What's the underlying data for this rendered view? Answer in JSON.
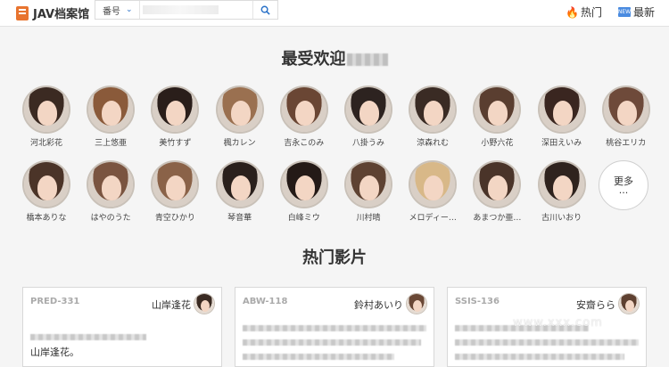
{
  "header": {
    "logo_text": "JAV档案馆",
    "search_select": "番号",
    "search_placeholder": "",
    "nav_hot": "热门",
    "nav_new": "最新",
    "new_badge": "NEW"
  },
  "sections": {
    "popular_title": "最受欢迎",
    "hot_movies_title": "热门影片"
  },
  "actresses": [
    {
      "name": "河北彩花",
      "hair": "#3b2a22"
    },
    {
      "name": "三上悠亜",
      "hair": "#8a5a3a"
    },
    {
      "name": "美竹すず",
      "hair": "#2a1e1a"
    },
    {
      "name": "楓カレン",
      "hair": "#9a7050"
    },
    {
      "name": "吉永このみ",
      "hair": "#6a4634"
    },
    {
      "name": "八掛うみ",
      "hair": "#2d2320"
    },
    {
      "name": "涼森れむ",
      "hair": "#3a2b24"
    },
    {
      "name": "小野六花",
      "hair": "#5a3e30"
    },
    {
      "name": "深田えいみ",
      "hair": "#3a2620"
    },
    {
      "name": "桃谷エリカ",
      "hair": "#6e4a3a"
    },
    {
      "name": "橋本ありな",
      "hair": "#4b3428"
    },
    {
      "name": "はやのうた",
      "hair": "#7a5440"
    },
    {
      "name": "青空ひかり",
      "hair": "#8a6248"
    },
    {
      "name": "琴音華",
      "hair": "#2a201c"
    },
    {
      "name": "白峰ミウ",
      "hair": "#241a17"
    },
    {
      "name": "川村晴",
      "hair": "#5e4232"
    },
    {
      "name": "メロディー…",
      "hair": "#d8b888"
    },
    {
      "name": "あまつか亜…",
      "hair": "#4a3429"
    },
    {
      "name": "古川いおり",
      "hair": "#2f231e"
    }
  ],
  "more_button": {
    "label": "更多",
    "dots": "···"
  },
  "movies": [
    {
      "code": "PRED-331",
      "actress": "山岸逢花",
      "text": "山岸逢花。",
      "hair": "#3a2a22"
    },
    {
      "code": "ABW-118",
      "actress": "鈴村あいり",
      "text": "",
      "hair": "#6a4836"
    },
    {
      "code": "SSIS-136",
      "actress": "安齋らら",
      "text": "",
      "hair": "#5e4030"
    }
  ],
  "watermark": "www.xxx.com"
}
